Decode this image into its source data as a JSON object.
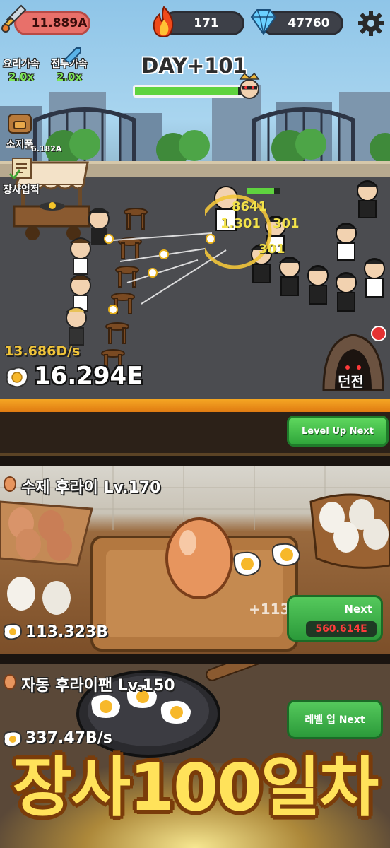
{
  "hud": {
    "power": "11.889A",
    "fire_count": "171",
    "gems": "47760"
  },
  "day": {
    "label": "DAY+101",
    "progress": 0.95
  },
  "left_menu": {
    "cooking_speed": {
      "label": "요리가속",
      "mult": "2.0x"
    },
    "combat_speed": {
      "label": "전투가속",
      "mult": "2.0x"
    },
    "inventory": {
      "label": "소지품"
    },
    "inventory_value": "6.182A",
    "achievements": {
      "label": "장사업적"
    }
  },
  "stats": {
    "rate": "13.686D/s",
    "eggs": "16.294E"
  },
  "dungeon": {
    "label": "던전"
  },
  "damage_numbers": [
    "8641",
    "1.301",
    "301",
    "301"
  ],
  "level_up": {
    "label": "Level Up Next"
  },
  "card1": {
    "title": "수제 후라이 Lv.170",
    "value": "113.323B",
    "float_text": "+113.3",
    "next_label": "Next",
    "cost": "560.614E"
  },
  "card2": {
    "title": "자동 후라이팬 Lv.150",
    "value": "337.47B/s",
    "next_label": "레벨 업 Next"
  },
  "banner": {
    "text": "장사100일차"
  },
  "colors": {
    "accent_green": "#5fd33f",
    "gold": "#f0c43a",
    "cost_red": "#ff3b3b",
    "power_pill": "#e8706a"
  }
}
